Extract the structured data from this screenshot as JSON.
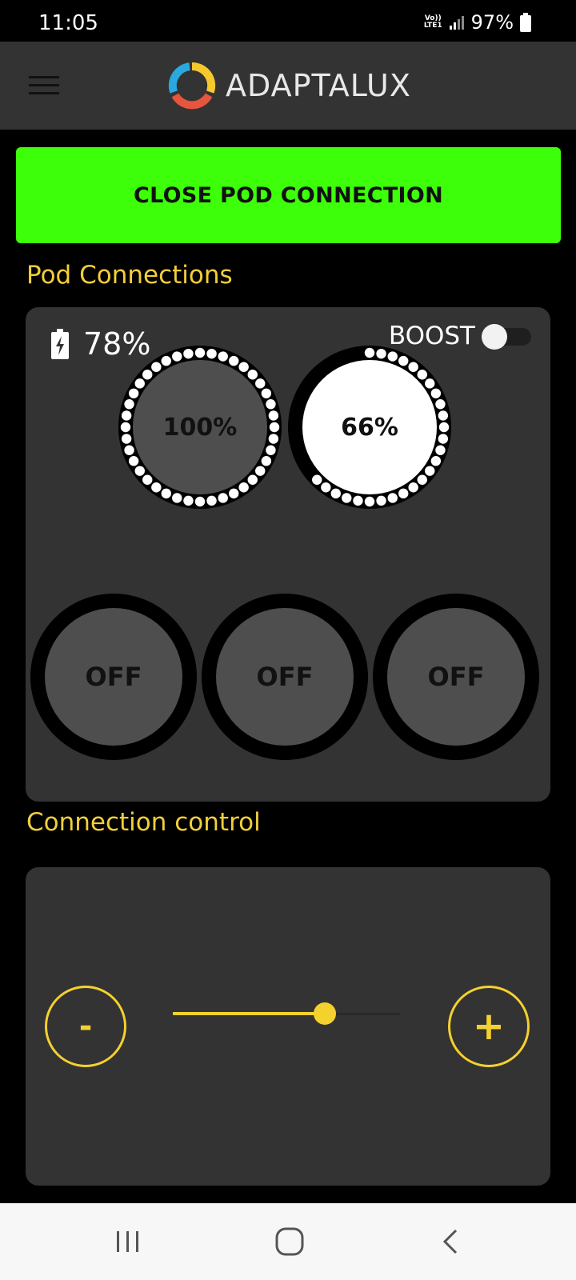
{
  "status_bar": {
    "time": "11:05",
    "network_top": "Vo))",
    "network_bottom": "LTE1",
    "battery": "97%"
  },
  "app_bar": {
    "logo_text": "ADAPTALUX",
    "menu_icon": "hamburger-menu-icon"
  },
  "actions": {
    "close_connection_label": "CLOSE POD CONNECTION"
  },
  "pod_connections": {
    "title": "Pod Connections",
    "battery_level": "78%",
    "boost_label": "BOOST",
    "boost_on": false,
    "dials": [
      {
        "label": "100%",
        "level": 100,
        "active": false
      },
      {
        "label": "66%",
        "level": 66,
        "active": true
      }
    ],
    "off_dials": [
      {
        "label": "OFF"
      },
      {
        "label": "OFF"
      },
      {
        "label": "OFF"
      }
    ]
  },
  "connection_control": {
    "title": "Connection control",
    "minus_label": "-",
    "plus_label": "+",
    "slider_fraction": 0.67
  },
  "colors": {
    "accent_yellow": "#f5d12e",
    "title_yellow": "#f2cf3a",
    "close_green": "#3dff0a",
    "card_gray": "#333333",
    "dial_gray": "#4e4e4e"
  }
}
